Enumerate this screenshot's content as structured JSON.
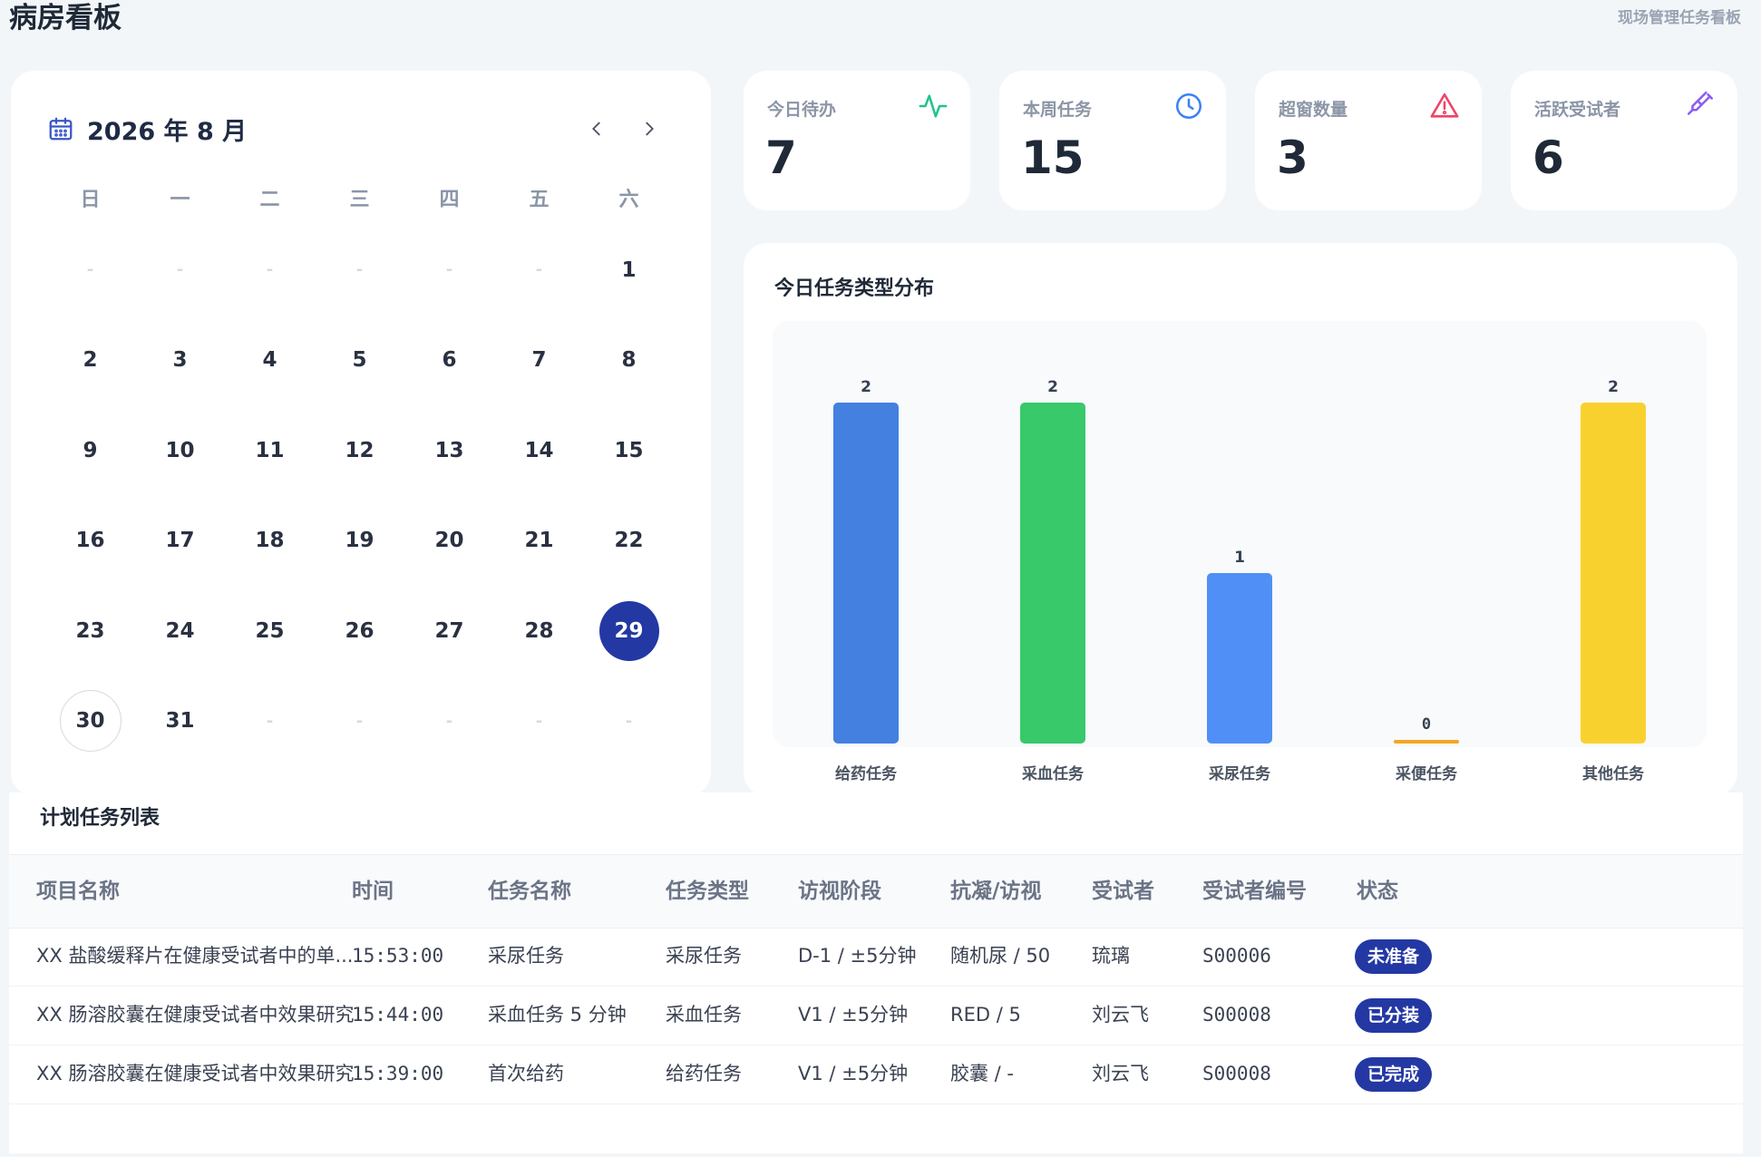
{
  "header": {
    "title": "病房看板",
    "subtitle": "现场管理任务看板"
  },
  "calendar": {
    "month_label": "2026 年 8 月",
    "weekdays": [
      "日",
      "一",
      "二",
      "三",
      "四",
      "五",
      "六"
    ],
    "empty_marker": "-",
    "selected_day": "29",
    "today_day": "30",
    "weeks": [
      [
        "-",
        "-",
        "-",
        "-",
        "-",
        "-",
        "1"
      ],
      [
        "2",
        "3",
        "4",
        "5",
        "6",
        "7",
        "8"
      ],
      [
        "9",
        "10",
        "11",
        "12",
        "13",
        "14",
        "15"
      ],
      [
        "16",
        "17",
        "18",
        "19",
        "20",
        "21",
        "22"
      ],
      [
        "23",
        "24",
        "25",
        "26",
        "27",
        "28",
        "29"
      ],
      [
        "30",
        "31",
        "-",
        "-",
        "-",
        "-",
        "-"
      ]
    ]
  },
  "stats": [
    {
      "label": "今日待办",
      "value": "7",
      "icon": "activity-icon",
      "color": "#22c38e"
    },
    {
      "label": "本周任务",
      "value": "15",
      "icon": "clock-icon",
      "color": "#3b82f6"
    },
    {
      "label": "超窗数量",
      "value": "3",
      "icon": "warning-icon",
      "color": "#ef4466"
    },
    {
      "label": "活跃受试者",
      "value": "6",
      "icon": "syringe-icon",
      "color": "#8b5cf6"
    }
  ],
  "chart_title": "今日任务类型分布",
  "chart_data": {
    "type": "bar",
    "title": "今日任务类型分布",
    "categories": [
      "给药任务",
      "采血任务",
      "采尿任务",
      "采便任务",
      "其他任务"
    ],
    "values": [
      2,
      2,
      1,
      0,
      2
    ],
    "colors": [
      "#4380e0",
      "#37c96a",
      "#5090f6",
      "#f5a623",
      "#f9d12e"
    ],
    "ylim": [
      0,
      2
    ],
    "grid": false,
    "xlabel": "",
    "ylabel": ""
  },
  "table": {
    "title": "计划任务列表",
    "headers": [
      "项目名称",
      "时间",
      "任务名称",
      "任务类型",
      "访视阶段",
      "抗凝/访视",
      "受试者",
      "受试者编号",
      "状态"
    ],
    "rows": [
      [
        "XX 盐酸缓释片在健康受试者中的单...",
        "15:53:00",
        "采尿任务",
        "采尿任务",
        "D-1 / ±5分钟",
        "随机尿 / 50",
        "琉璃",
        "S00006",
        "未准备"
      ],
      [
        "XX 肠溶胶囊在健康受试者中效果研究",
        "15:44:00",
        "采血任务 5 分钟",
        "采血任务",
        "V1 / ±5分钟",
        "RED / 5",
        "刘云飞",
        "S00008",
        "已分装"
      ],
      [
        "XX 肠溶胶囊在健康受试者中效果研究",
        "15:39:00",
        "首次给药",
        "给药任务",
        "V1 / ±5分钟",
        "胶囊 / -",
        "刘云飞",
        "S00008",
        "已完成"
      ]
    ]
  }
}
